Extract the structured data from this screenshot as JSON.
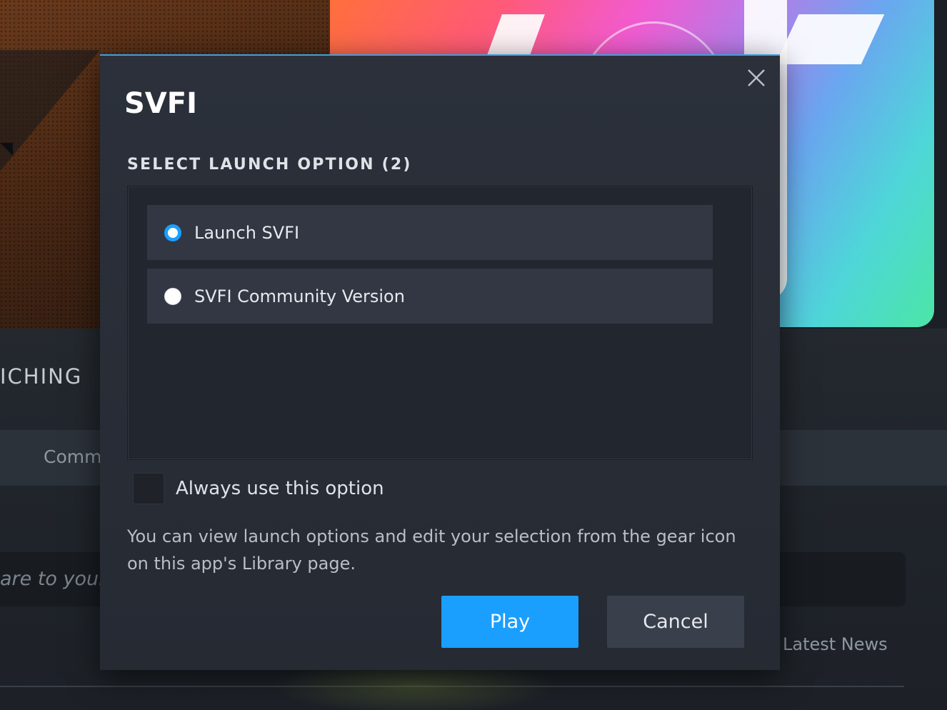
{
  "background": {
    "section_heading": "ICHING",
    "tab_label": "Comm",
    "input_placeholder": "are to your",
    "latest_news": "Latest News"
  },
  "dialog": {
    "title": "SVFI",
    "section_label": "SELECT LAUNCH OPTION (2)",
    "options": [
      {
        "label": "Launch SVFI",
        "selected": true
      },
      {
        "label": "SVFI Community Version",
        "selected": false
      }
    ],
    "always_use_label": "Always use this option",
    "always_use_checked": false,
    "hint_text": "You can view launch options and edit your selection from the gear icon on this app's Library page.",
    "play_label": "Play",
    "cancel_label": "Cancel",
    "close_icon": "close-icon"
  },
  "colors": {
    "accent": "#1a9fff",
    "dialog_bg": "#2b303a",
    "option_bg": "#323743",
    "cancel_bg": "#3a404b"
  }
}
